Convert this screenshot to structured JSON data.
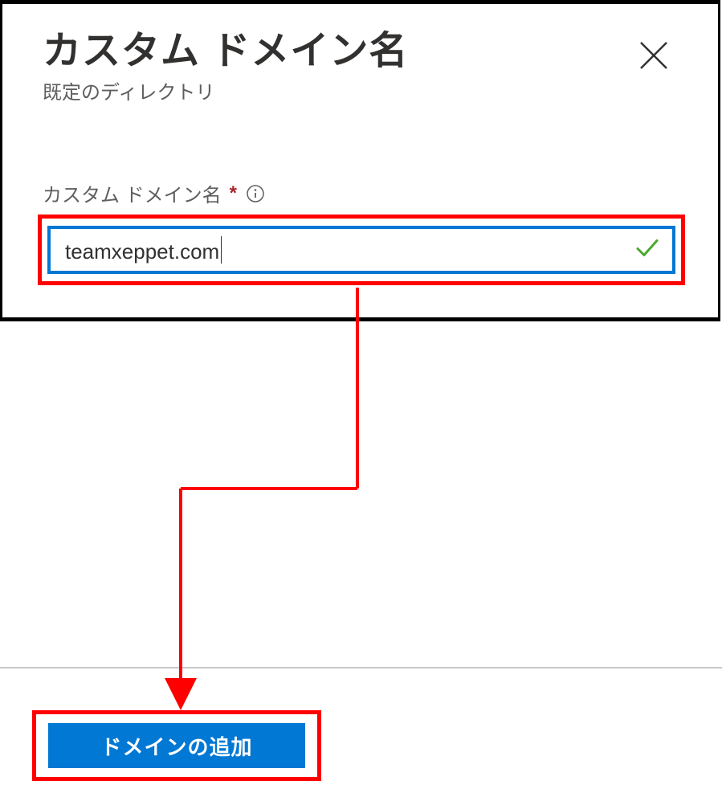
{
  "header": {
    "title": "カスタム ドメイン名",
    "subtitle": "既定のディレクトリ"
  },
  "field": {
    "label": "カスタム ドメイン名",
    "required_marker": "*",
    "value": "teamxeppet.com",
    "validation": "valid"
  },
  "actions": {
    "add_domain_label": "ドメインの追加"
  },
  "icons": {
    "close": "close-icon",
    "info": "info-icon",
    "check": "checkmark-icon"
  },
  "annotation": {
    "highlight_color": "#ff0000",
    "accent_color": "#0078d4"
  }
}
